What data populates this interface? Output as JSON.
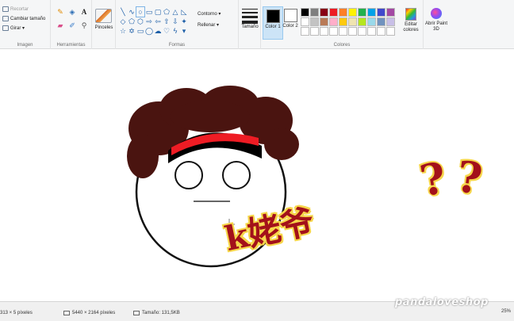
{
  "ribbon": {
    "image_group": {
      "label": "Imagen",
      "crop": "Recortar",
      "resize": "Cambiar tamaño",
      "rotate": "Girar ▾"
    },
    "tools_group": {
      "label": "Herramientas"
    },
    "brushes": {
      "label": "Pinceles"
    },
    "shapes_group": {
      "label": "Formas",
      "outline": "Contorno ▾",
      "fill": "Rellenar ▾"
    },
    "size": {
      "label": "Tamaño"
    },
    "colors_group": {
      "label": "Colores",
      "color1_label": "Color 1",
      "color2_label": "Color 2",
      "color1": "#000000",
      "color2": "#ffffff",
      "edit_colors": "Editar colores",
      "palette": [
        "#000000",
        "#7f7f7f",
        "#880015",
        "#ed1c24",
        "#ff7f27",
        "#fff200",
        "#22b14c",
        "#00a2e8",
        "#3f48cc",
        "#a349a4",
        "#ffffff",
        "#c3c3c3",
        "#b97a57",
        "#ffaec9",
        "#ffc90e",
        "#efe4b0",
        "#b5e61d",
        "#99d9ea",
        "#7092be",
        "#c8bfe7",
        "#ffffff",
        "#ffffff",
        "#ffffff",
        "#ffffff",
        "#ffffff",
        "#ffffff",
        "#ffffff",
        "#ffffff",
        "#ffffff",
        "#ffffff"
      ]
    },
    "paint3d": {
      "label": "Abrir Paint 3D"
    }
  },
  "canvas": {
    "caption_text": "k姥爷",
    "question_mark": "?",
    "hair_color": "#4a1410",
    "band_red": "#ee1c24"
  },
  "statusbar": {
    "cursor_pos": "313 × 5 píxeles",
    "image_size": "5440 × 2164 píxeles",
    "file_size": "Tamaño: 131,5KB",
    "zoom": "25%"
  },
  "watermark": "pandaloveshop"
}
